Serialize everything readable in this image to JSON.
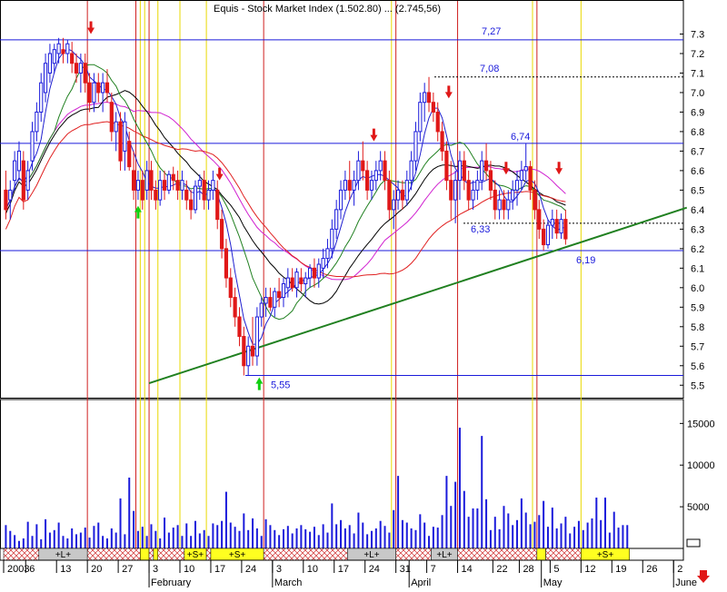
{
  "title": "Equis - Stock Market Index (1.502.80) ... (2.745,56)",
  "colors": {
    "bull": "#1a1adb",
    "bear": "#e01818",
    "ma_short": "#2020d0",
    "ma_mid": "#208020",
    "ma_long": "#e02020",
    "ma_slow": "#d020d0",
    "ma_black": "#000000",
    "trendline": "#208020",
    "volume": "#1a1adb",
    "red_vline": "#d02020",
    "yellow_vline": "#e8d800",
    "level_line": "#1a1adb"
  },
  "levels": [
    {
      "value": 7.27,
      "label": "7,27"
    },
    {
      "value": 7.08,
      "label": "7,08",
      "dashed": true
    },
    {
      "value": 6.74,
      "label": "6,74"
    },
    {
      "value": 6.33,
      "label": "6,33",
      "dashed": true
    },
    {
      "value": 6.19,
      "label": "6,19"
    },
    {
      "value": 5.55,
      "label": "5,55"
    }
  ],
  "y_ticks": [
    "7.3",
    "7.2",
    "7.1",
    "7.0",
    "6.9",
    "6.8",
    "6.7",
    "6.6",
    "6.5",
    "6.4",
    "6.3",
    "6.2",
    "6.1",
    "6.0",
    "5.9",
    "5.8",
    "5.7",
    "5.6",
    "5.5"
  ],
  "vol_ticks": [
    "15000",
    "10000",
    "5000"
  ],
  "date_labels": [
    {
      "label": "2003",
      "day": 0
    },
    {
      "label": "6",
      "day": 5
    },
    {
      "label": "13",
      "day": 12
    },
    {
      "label": "20",
      "day": 19
    },
    {
      "label": "27",
      "day": 26
    },
    {
      "label": "3",
      "day": 33
    },
    {
      "label": "10",
      "day": 40
    },
    {
      "label": "17",
      "day": 47
    },
    {
      "label": "24",
      "day": 54
    },
    {
      "label": "3",
      "day": 61
    },
    {
      "label": "10",
      "day": 68
    },
    {
      "label": "17",
      "day": 75
    },
    {
      "label": "24",
      "day": 82
    },
    {
      "label": "31",
      "day": 89
    },
    {
      "label": "7",
      "day": 96
    },
    {
      "label": "14",
      "day": 103
    },
    {
      "label": "22",
      "day": 111
    },
    {
      "label": "28",
      "day": 117
    },
    {
      "label": "5",
      "day": 124
    },
    {
      "label": "12",
      "day": 131
    },
    {
      "label": "19",
      "day": 138
    },
    {
      "label": "26",
      "day": 145
    },
    {
      "label": "2",
      "day": 152
    }
  ],
  "month_labels": [
    {
      "label": "February",
      "day": 33
    },
    {
      "label": "March",
      "day": 61
    },
    {
      "label": "April",
      "day": 92
    },
    {
      "label": "May",
      "day": 122
    },
    {
      "label": "June",
      "day": 152
    }
  ],
  "band_segments": [
    {
      "from": 0,
      "to": 8,
      "kind": "hatch"
    },
    {
      "from": 8,
      "to": 19,
      "kind": "L",
      "label": "+L+"
    },
    {
      "from": 19,
      "to": 31,
      "kind": "hatch"
    },
    {
      "from": 31,
      "to": 33,
      "kind": "S"
    },
    {
      "from": 33,
      "to": 34,
      "kind": "hatch"
    },
    {
      "from": 34,
      "to": 35,
      "kind": "S"
    },
    {
      "from": 35,
      "to": 41,
      "kind": "hatch"
    },
    {
      "from": 41,
      "to": 46,
      "kind": "S",
      "label": "+S+"
    },
    {
      "from": 46,
      "to": 47,
      "kind": "hatch"
    },
    {
      "from": 47,
      "to": 59,
      "kind": "S",
      "label": "+S+"
    },
    {
      "from": 59,
      "to": 78,
      "kind": "hatch"
    },
    {
      "from": 78,
      "to": 89,
      "kind": "L",
      "label": "+L+"
    },
    {
      "from": 89,
      "to": 97,
      "kind": "hatch"
    },
    {
      "from": 97,
      "to": 103,
      "kind": "L",
      "label": "+L+"
    },
    {
      "from": 103,
      "to": 121,
      "kind": "hatch"
    },
    {
      "from": 121,
      "to": 123,
      "kind": "S"
    },
    {
      "from": 123,
      "to": 131,
      "kind": "hatch"
    },
    {
      "from": 131,
      "to": 142,
      "kind": "S",
      "label": "+S+"
    }
  ],
  "red_vlines": [
    19,
    30,
    33,
    59,
    89,
    103,
    121
  ],
  "yellow_vlines": [
    31,
    32,
    35,
    40,
    46,
    88,
    120,
    131
  ],
  "trendline": {
    "x1": 33,
    "y1": 5.51,
    "x2": 155,
    "y2": 6.41
  },
  "chart_data": {
    "type": "candlestick",
    "title": "",
    "ylim": [
      5.45,
      7.4
    ],
    "candles": [
      [
        6.5,
        6.6,
        6.35,
        6.4
      ],
      [
        6.45,
        6.55,
        6.35,
        6.5
      ],
      [
        6.55,
        6.7,
        6.5,
        6.65
      ],
      [
        6.6,
        6.75,
        6.55,
        6.7
      ],
      [
        6.65,
        6.7,
        6.4,
        6.45
      ],
      [
        6.5,
        6.65,
        6.45,
        6.6
      ],
      [
        6.65,
        6.85,
        6.6,
        6.8
      ],
      [
        6.8,
        6.95,
        6.75,
        6.9
      ],
      [
        6.9,
        7.1,
        6.85,
        7.05
      ],
      [
        7.0,
        7.2,
        6.95,
        7.15
      ],
      [
        7.1,
        7.25,
        7.05,
        7.2
      ],
      [
        7.15,
        7.25,
        7.1,
        7.22
      ],
      [
        7.2,
        7.28,
        7.15,
        7.25
      ],
      [
        7.22,
        7.28,
        7.15,
        7.2
      ],
      [
        7.2,
        7.27,
        7.15,
        7.25
      ],
      [
        7.2,
        7.26,
        7.1,
        7.15
      ],
      [
        7.15,
        7.2,
        7.05,
        7.1
      ],
      [
        7.1,
        7.2,
        7.0,
        7.15
      ],
      [
        7.15,
        7.2,
        7.0,
        7.05
      ],
      [
        7.05,
        7.1,
        6.9,
        6.95
      ],
      [
        6.95,
        7.1,
        6.9,
        7.05
      ],
      [
        7.05,
        7.1,
        6.95,
        7.0
      ],
      [
        7.0,
        7.1,
        6.9,
        7.05
      ],
      [
        7.05,
        7.12,
        6.95,
        7.0
      ],
      [
        6.95,
        7.0,
        6.75,
        6.8
      ],
      [
        6.8,
        6.9,
        6.7,
        6.85
      ],
      [
        6.85,
        6.9,
        6.6,
        6.65
      ],
      [
        6.7,
        6.9,
        6.6,
        6.85
      ],
      [
        6.75,
        6.8,
        6.6,
        6.62
      ],
      [
        6.6,
        6.7,
        6.45,
        6.5
      ],
      [
        6.5,
        6.6,
        6.45,
        6.55
      ],
      [
        6.55,
        6.6,
        6.4,
        6.45
      ],
      [
        6.5,
        6.65,
        6.45,
        6.6
      ],
      [
        6.6,
        6.65,
        6.45,
        6.5
      ],
      [
        6.5,
        6.55,
        6.4,
        6.45
      ],
      [
        6.45,
        6.6,
        6.42,
        6.55
      ],
      [
        6.55,
        6.6,
        6.45,
        6.5
      ],
      [
        6.5,
        6.6,
        6.48,
        6.58
      ],
      [
        6.58,
        6.62,
        6.5,
        6.55
      ],
      [
        6.55,
        6.6,
        6.45,
        6.5
      ],
      [
        6.5,
        6.6,
        6.45,
        6.55
      ],
      [
        6.5,
        6.55,
        6.4,
        6.45
      ],
      [
        6.45,
        6.5,
        6.35,
        6.4
      ],
      [
        6.4,
        6.55,
        6.38,
        6.52
      ],
      [
        6.52,
        6.58,
        6.45,
        6.55
      ],
      [
        6.55,
        6.6,
        6.4,
        6.45
      ],
      [
        6.45,
        6.55,
        6.4,
        6.5
      ],
      [
        6.5,
        6.6,
        6.45,
        6.55
      ],
      [
        6.5,
        6.55,
        6.3,
        6.35
      ],
      [
        6.35,
        6.4,
        6.15,
        6.2
      ],
      [
        6.2,
        6.25,
        6.0,
        6.05
      ],
      [
        6.05,
        6.1,
        5.9,
        5.95
      ],
      [
        5.95,
        6.0,
        5.8,
        5.85
      ],
      [
        5.85,
        5.9,
        5.7,
        5.75
      ],
      [
        5.75,
        5.8,
        5.55,
        5.6
      ],
      [
        5.6,
        5.75,
        5.55,
        5.7
      ],
      [
        5.7,
        5.85,
        5.6,
        5.65
      ],
      [
        5.65,
        5.9,
        5.6,
        5.85
      ],
      [
        5.85,
        5.95,
        5.8,
        5.92
      ],
      [
        5.92,
        6.0,
        5.85,
        5.95
      ],
      [
        5.95,
        6.0,
        5.88,
        5.9
      ],
      [
        5.9,
        6.0,
        5.85,
        5.98
      ],
      [
        5.98,
        6.05,
        5.9,
        5.95
      ],
      [
        5.95,
        6.05,
        5.9,
        6.02
      ],
      [
        6.0,
        6.1,
        5.95,
        6.05
      ],
      [
        6.05,
        6.1,
        5.98,
        6.0
      ],
      [
        6.0,
        6.1,
        5.95,
        6.08
      ],
      [
        6.05,
        6.1,
        5.98,
        6.02
      ],
      [
        6.02,
        6.08,
        5.95,
        6.05
      ],
      [
        6.05,
        6.12,
        6.0,
        6.1
      ],
      [
        6.1,
        6.15,
        6.0,
        6.05
      ],
      [
        6.05,
        6.15,
        6.0,
        6.12
      ],
      [
        6.1,
        6.2,
        6.05,
        6.15
      ],
      [
        6.15,
        6.25,
        6.1,
        6.2
      ],
      [
        6.2,
        6.35,
        6.15,
        6.3
      ],
      [
        6.3,
        6.45,
        6.25,
        6.4
      ],
      [
        6.4,
        6.55,
        6.35,
        6.5
      ],
      [
        6.5,
        6.6,
        6.45,
        6.55
      ],
      [
        6.55,
        6.65,
        6.45,
        6.5
      ],
      [
        6.5,
        6.6,
        6.42,
        6.55
      ],
      [
        6.55,
        6.7,
        6.5,
        6.65
      ],
      [
        6.65,
        6.75,
        6.55,
        6.6
      ],
      [
        6.6,
        6.65,
        6.45,
        6.5
      ],
      [
        6.5,
        6.6,
        6.45,
        6.55
      ],
      [
        6.55,
        6.65,
        6.5,
        6.6
      ],
      [
        6.6,
        6.7,
        6.55,
        6.65
      ],
      [
        6.65,
        6.7,
        6.5,
        6.55
      ],
      [
        6.55,
        6.6,
        6.35,
        6.4
      ],
      [
        6.4,
        6.5,
        6.3,
        6.45
      ],
      [
        6.45,
        6.55,
        6.4,
        6.5
      ],
      [
        6.5,
        6.55,
        6.4,
        6.45
      ],
      [
        6.45,
        6.6,
        6.42,
        6.55
      ],
      [
        6.55,
        6.7,
        6.5,
        6.65
      ],
      [
        6.65,
        6.85,
        6.6,
        6.8
      ],
      [
        6.8,
        7.0,
        6.75,
        6.95
      ],
      [
        6.95,
        7.05,
        6.85,
        7.0
      ],
      [
        7.0,
        7.08,
        6.9,
        6.95
      ],
      [
        6.95,
        7.0,
        6.85,
        6.9
      ],
      [
        6.9,
        6.95,
        6.75,
        6.8
      ],
      [
        6.8,
        6.85,
        6.65,
        6.7
      ],
      [
        6.7,
        6.75,
        6.5,
        6.55
      ],
      [
        6.55,
        6.65,
        6.35,
        6.45
      ],
      [
        6.45,
        6.6,
        6.33,
        6.55
      ],
      [
        6.55,
        6.7,
        6.45,
        6.65
      ],
      [
        6.65,
        6.7,
        6.5,
        6.55
      ],
      [
        6.55,
        6.6,
        6.4,
        6.45
      ],
      [
        6.45,
        6.55,
        6.4,
        6.5
      ],
      [
        6.5,
        6.6,
        6.45,
        6.55
      ],
      [
        6.55,
        6.7,
        6.5,
        6.65
      ],
      [
        6.65,
        6.74,
        6.55,
        6.6
      ],
      [
        6.6,
        6.65,
        6.45,
        6.5
      ],
      [
        6.5,
        6.55,
        6.35,
        6.4
      ],
      [
        6.4,
        6.5,
        6.35,
        6.45
      ],
      [
        6.45,
        6.5,
        6.35,
        6.4
      ],
      [
        6.4,
        6.5,
        6.35,
        6.45
      ],
      [
        6.45,
        6.55,
        6.4,
        6.5
      ],
      [
        6.5,
        6.6,
        6.42,
        6.55
      ],
      [
        6.55,
        6.65,
        6.5,
        6.6
      ],
      [
        6.6,
        6.74,
        6.55,
        6.62
      ],
      [
        6.62,
        6.65,
        6.45,
        6.5
      ],
      [
        6.5,
        6.55,
        6.35,
        6.4
      ],
      [
        6.4,
        6.45,
        6.25,
        6.3
      ],
      [
        6.3,
        6.35,
        6.19,
        6.22
      ],
      [
        6.22,
        6.35,
        6.2,
        6.32
      ],
      [
        6.32,
        6.4,
        6.25,
        6.35
      ],
      [
        6.35,
        6.4,
        6.25,
        6.28
      ],
      [
        6.28,
        6.38,
        6.25,
        6.35
      ],
      [
        6.35,
        6.4,
        6.22,
        6.25
      ]
    ],
    "volume": [
      2800,
      2100,
      1600,
      900,
      1200,
      3200,
      1500,
      2900,
      1100,
      3500,
      1900,
      2200,
      3100,
      1500,
      1200,
      2400,
      1700,
      1900,
      2500,
      1300,
      2700,
      3100,
      1500,
      1200,
      2400,
      1900,
      6000,
      1700,
      8500,
      4500,
      2100,
      2600,
      1500,
      2900,
      2100,
      1200,
      3700,
      1900,
      2500,
      2800,
      1500,
      3000,
      1500,
      3300,
      1800,
      2200,
      1500,
      3000,
      2800,
      3300,
      6800,
      3100,
      2600,
      2100,
      4200,
      2200,
      3600,
      2400,
      1500,
      3500,
      2800,
      2200,
      1600,
      2300,
      2700,
      1800,
      2400,
      2800,
      2300,
      2000,
      2600,
      1600,
      2900,
      1900,
      5400,
      2900,
      3400,
      2400,
      2800,
      1800,
      4300,
      3100,
      1700,
      2100,
      2400,
      3300,
      2700,
      1900,
      4600,
      8700,
      3400,
      3100,
      2400,
      2200,
      4100,
      3100,
      1500,
      2600,
      2500,
      4000,
      8700,
      5100,
      8000,
      14500,
      6900,
      3800,
      4800,
      4800,
      13500,
      5900,
      2200,
      3800,
      2300,
      5100,
      4200,
      2800,
      3400,
      6000,
      4300,
      2900,
      3200,
      4000,
      5700,
      2600,
      4900,
      2400,
      3000,
      3800,
      1800,
      2600,
      3300,
      2200,
      3100,
      3600,
      6100,
      3400,
      6100,
      1900,
      4400,
      2500,
      2800,
      2800
    ],
    "vol_ylim": [
      0,
      17000
    ]
  }
}
